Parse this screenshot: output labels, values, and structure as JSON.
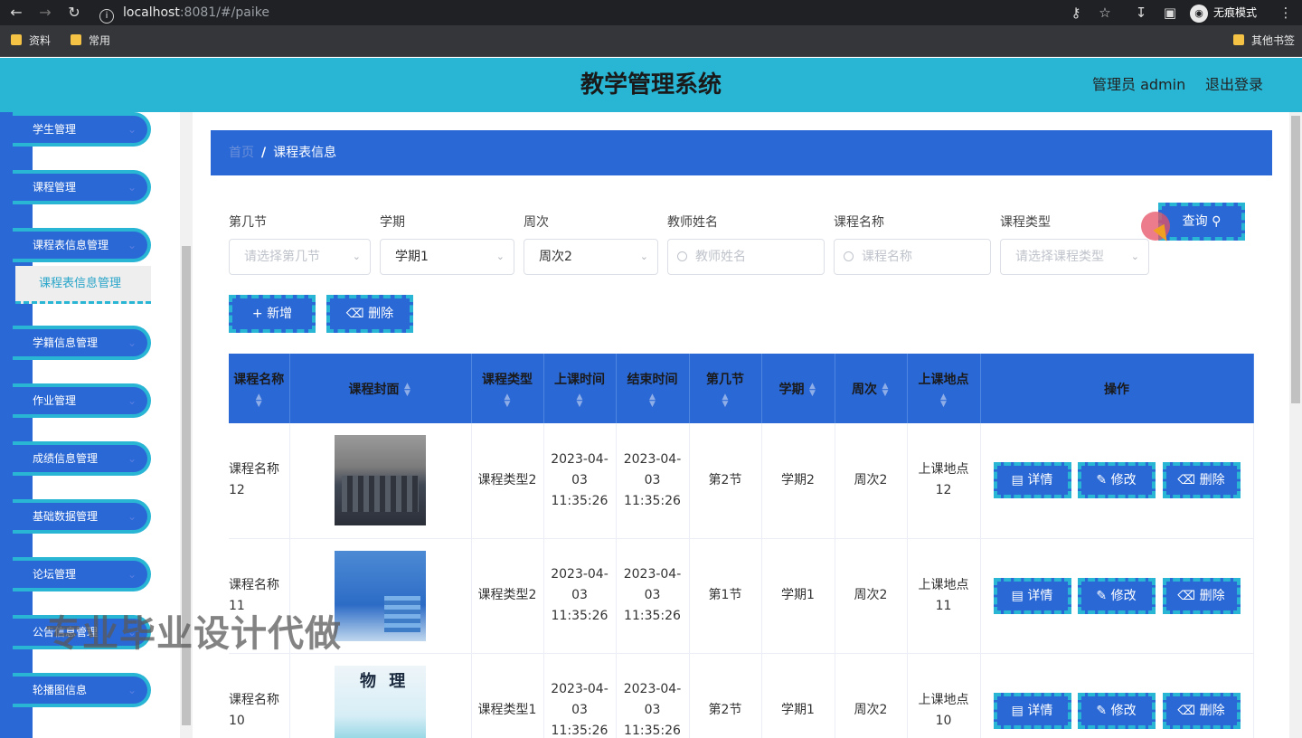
{
  "browser": {
    "url_host": "localhost",
    "url_path": ":8081/#/paike",
    "incognito_label": "无痕模式",
    "bookmarks": [
      "资料",
      "常用"
    ],
    "other_bookmarks": "其他书签"
  },
  "header": {
    "title": "教学管理系统",
    "user": "管理员 admin",
    "logout": "退出登录"
  },
  "sidebar": {
    "items": [
      "学生管理",
      "课程管理",
      "课程表信息管理",
      "学籍信息管理",
      "作业管理",
      "成绩信息管理",
      "基础数据管理",
      "论坛管理",
      "公告信息管理",
      "轮播图信息"
    ],
    "sub_item": "课程表信息管理"
  },
  "breadcrumb": {
    "home": "首页",
    "current": "课程表信息"
  },
  "filters": {
    "section": {
      "label": "第几节",
      "placeholder": "请选择第几节"
    },
    "term": {
      "label": "学期",
      "value": "学期1"
    },
    "week": {
      "label": "周次",
      "value": "周次2"
    },
    "teacher": {
      "label": "教师姓名",
      "placeholder": "教师姓名"
    },
    "course": {
      "label": "课程名称",
      "placeholder": "课程名称"
    },
    "type": {
      "label": "课程类型",
      "placeholder": "请选择课程类型"
    },
    "query_button": "查询"
  },
  "toolbar": {
    "add": "新增",
    "delete": "删除"
  },
  "table": {
    "columns": [
      "课程名称",
      "课程封面",
      "课程类型",
      "上课时间",
      "结束时间",
      "第几节",
      "学期",
      "周次",
      "上课地点",
      "操作"
    ],
    "actions": {
      "detail": "详情",
      "edit": "修改",
      "delete": "删除"
    },
    "rows": [
      {
        "name": "课程名称12",
        "type": "课程类型2",
        "start": "2023-04-03 11:35:26",
        "end": "2023-04-03 11:35:26",
        "section": "第2节",
        "term": "学期2",
        "week": "周次2",
        "place": "上课地点12"
      },
      {
        "name": "课程名称11",
        "type": "课程类型2",
        "start": "2023-04-03 11:35:26",
        "end": "2023-04-03 11:35:26",
        "section": "第1节",
        "term": "学期1",
        "week": "周次2",
        "place": "上课地点11"
      },
      {
        "name": "课程名称10",
        "type": "课程类型1",
        "start": "2023-04-03 11:35:26",
        "end": "2023-04-03 11:35:26",
        "section": "第2节",
        "term": "学期1",
        "week": "周次2",
        "place": "上课地点10"
      }
    ]
  },
  "overlay": {
    "watermark": "专业毕业设计代做",
    "book_cover_text": "物 理"
  }
}
